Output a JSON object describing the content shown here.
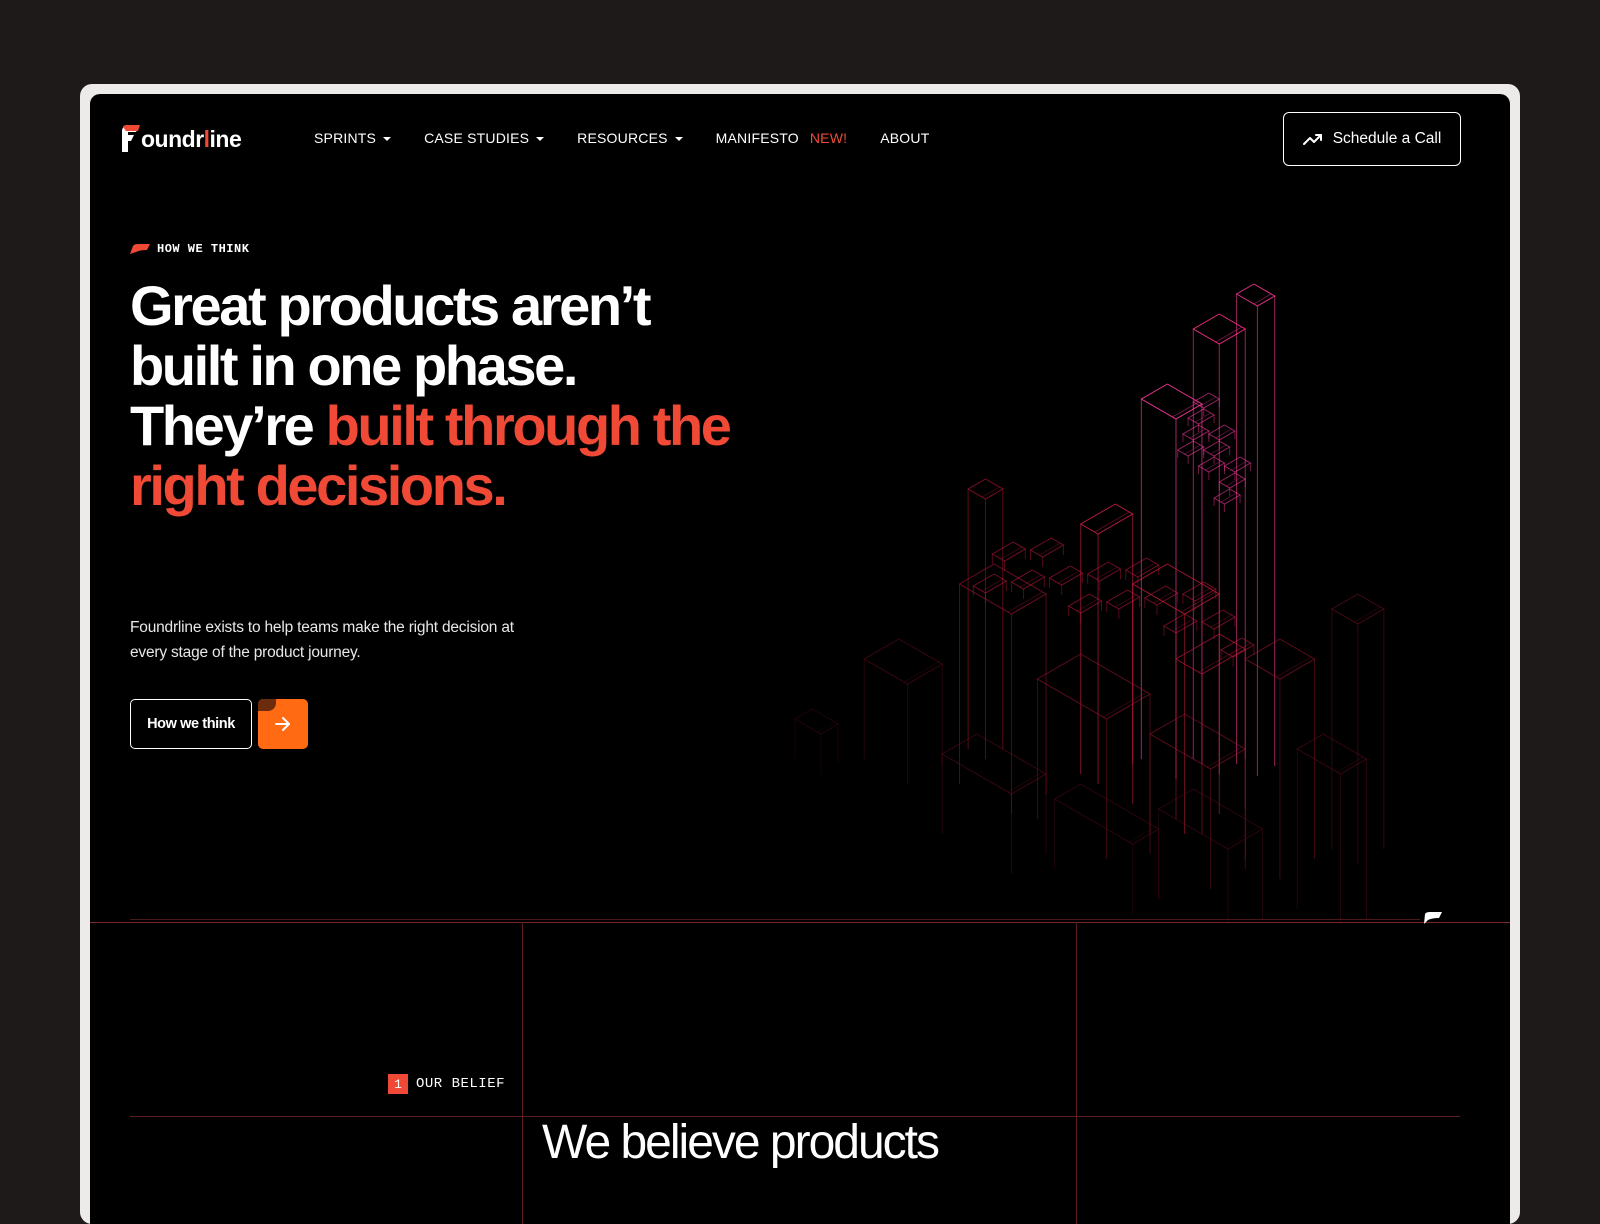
{
  "brand": {
    "logo_prefix": "oundr",
    "logo_accent": "l",
    "logo_suffix": "ine",
    "accent_color": "#f04a37",
    "orange_color": "#ff6a13"
  },
  "nav": {
    "items": [
      {
        "label": "SPRINTS",
        "has_dropdown": true
      },
      {
        "label": "CASE STUDIES",
        "has_dropdown": true
      },
      {
        "label": "RESOURCES",
        "has_dropdown": true
      },
      {
        "label": "MANIFESTO",
        "badge": "NEW!",
        "has_dropdown": false
      },
      {
        "label": "ABOUT",
        "has_dropdown": false
      }
    ],
    "cta_label": "Schedule a Call",
    "cta_icon": "trending-up-icon"
  },
  "hero": {
    "eyebrow": "HOW WE THINK",
    "headline_white": "Great products aren’t built in one phase. They’re",
    "headline_accent": "built through the right decisions.",
    "description": "Foundrline exists to help teams make the right decision at every stage of the product journey.",
    "primary_button": "How we think",
    "arrow_icon": "arrow-right-icon"
  },
  "belief": {
    "number": "1",
    "label": "OUR BELIEF",
    "headline": "We believe products"
  }
}
